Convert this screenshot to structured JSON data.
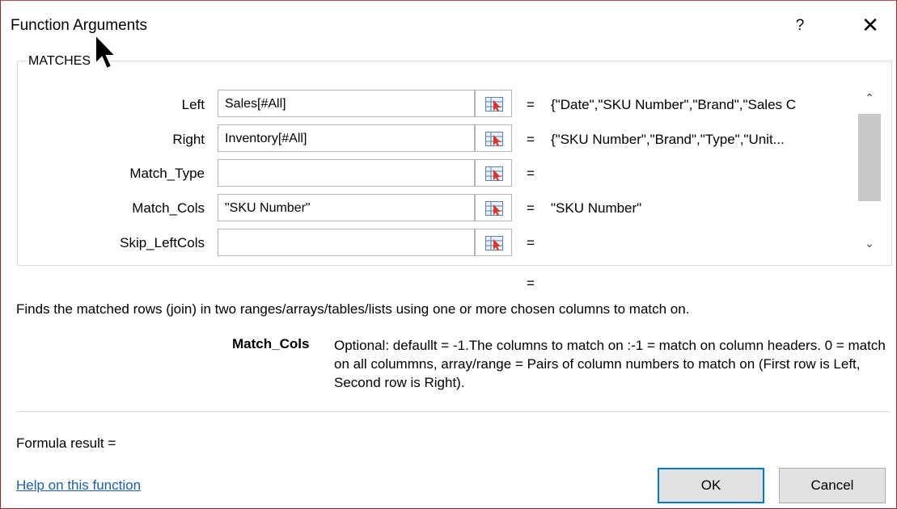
{
  "window": {
    "title": "Function Arguments",
    "help_glyph": "?",
    "close_glyph": "✕"
  },
  "function_group": {
    "name": "MATCHES",
    "arguments": [
      {
        "label": "Left",
        "value": "Sales[#All]",
        "result": "{\"Date\",\"SKU Number\",\"Brand\",\"Sales C"
      },
      {
        "label": "Right",
        "value": "Inventory[#All]",
        "result": "{\"SKU Number\",\"Brand\",\"Type\",\"Unit..."
      },
      {
        "label": "Match_Type",
        "value": "",
        "result": ""
      },
      {
        "label": "Match_Cols",
        "value": "\"SKU Number\"",
        "result": "\"SKU Number\""
      },
      {
        "label": "Skip_LeftCols",
        "value": "",
        "result": ""
      }
    ],
    "equals": "="
  },
  "scrollbar": {
    "up_glyph": "⌃",
    "down_glyph": "⌄"
  },
  "function_result_equals": "=",
  "description": "Finds the matched rows (join) in two ranges/arrays/tables/lists using one or more chosen columns to match on.",
  "parameter_help": {
    "name": "Match_Cols",
    "text": "Optional: defaullt = -1.The columns to match on :-1 = match on column headers. 0 = match on all colummns, array/range = Pairs of column numbers to match on (First row is Left, Second row is Right)."
  },
  "formula_result": {
    "label": "Formula result =",
    "value": ""
  },
  "help_link": "Help on this function",
  "buttons": {
    "ok": "OK",
    "cancel": "Cancel"
  },
  "colors": {
    "link": "#1a5fb4",
    "ok_border": "#0078d7",
    "window_border": "#9a2a2a"
  }
}
